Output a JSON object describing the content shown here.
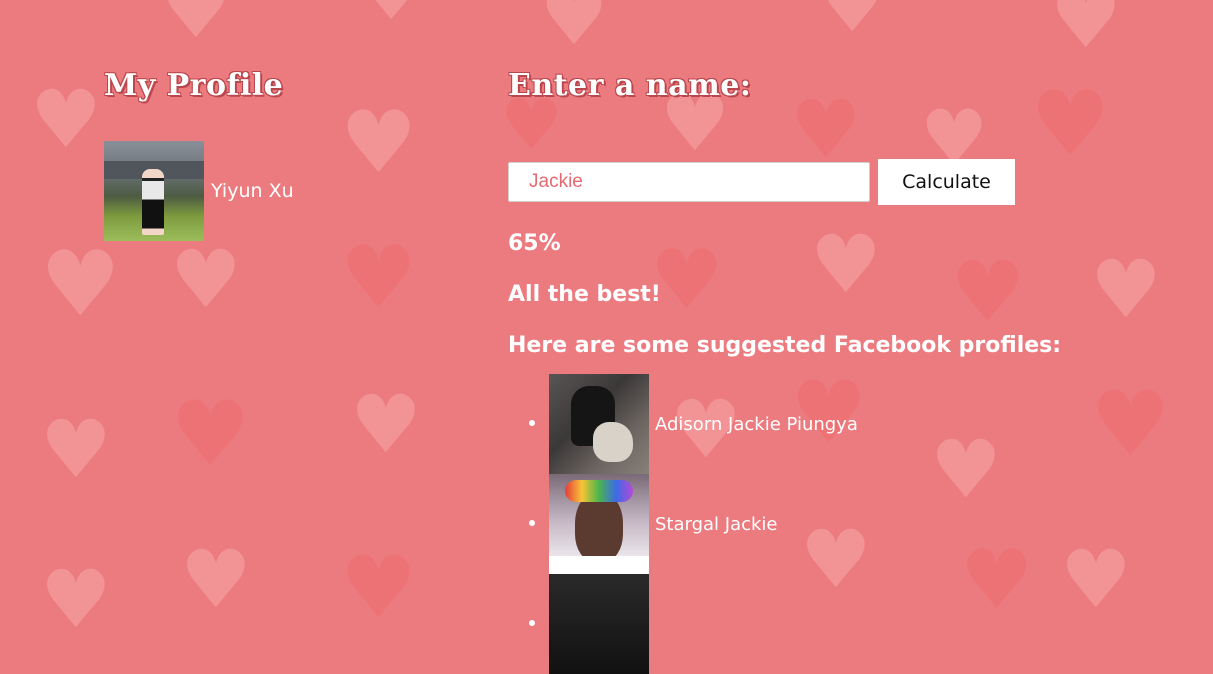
{
  "left": {
    "title": "My Profile",
    "profile_name": "Yiyun Xu"
  },
  "right": {
    "title": "Enter a name:",
    "input_value": "Jackie",
    "button_label": "Calculate",
    "result_percent": "65%",
    "message": "All the best!",
    "suggest_title": "Here are some suggested Facebook profiles:",
    "suggestions": [
      {
        "name": "Adisorn Jackie Piungya"
      },
      {
        "name": "Stargal Jackie"
      },
      {
        "name": ""
      }
    ]
  },
  "colors": {
    "background": "#ec7b80",
    "heart": "#f7a9a9",
    "text": "#ffffff",
    "input_text": "#e36a70"
  },
  "icons": {
    "background_pattern": "heart-icon"
  }
}
